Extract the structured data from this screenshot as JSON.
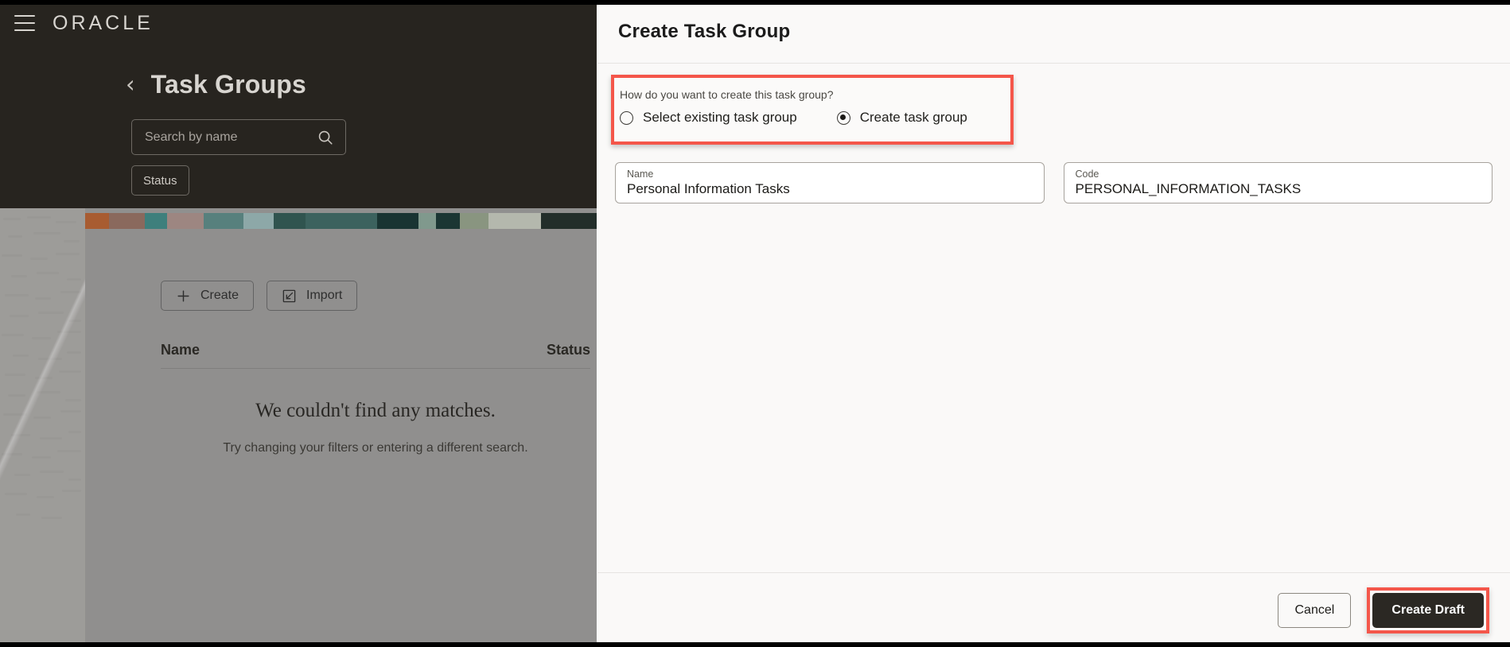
{
  "background_app": {
    "brand": "ORACLE",
    "menu_icon": "hamburger-icon",
    "back_icon": "chevron-left-icon",
    "page_title": "Task Groups",
    "search": {
      "placeholder": "Search by name",
      "value": "",
      "icon": "search-icon"
    },
    "filters": [
      {
        "label": "Status"
      }
    ],
    "toolbar": [
      {
        "label": "Create",
        "icon": "plus-icon"
      },
      {
        "label": "Import",
        "icon": "import-arrow-icon"
      }
    ],
    "table": {
      "columns": [
        "Name",
        "Status"
      ]
    },
    "empty_state": {
      "title": "We couldn't find any matches.",
      "subtitle": "Try changing your filters or entering a different search."
    }
  },
  "drawer": {
    "title": "Create Task Group",
    "question": "How do you want to create this task group?",
    "options": [
      {
        "label": "Select existing task group",
        "selected": false
      },
      {
        "label": "Create task group",
        "selected": true
      }
    ],
    "fields": [
      {
        "label": "Name",
        "value": "Personal Information Tasks"
      },
      {
        "label": "Code",
        "value": "PERSONAL_INFORMATION_TASKS"
      }
    ],
    "footer": {
      "cancel_label": "Cancel",
      "primary_label": "Create Draft"
    }
  },
  "colors": {
    "highlight": "#f4564a",
    "dark_header": "#27241f",
    "primary_button": "#2b2823",
    "drawer_bg": "#faf9f8"
  }
}
